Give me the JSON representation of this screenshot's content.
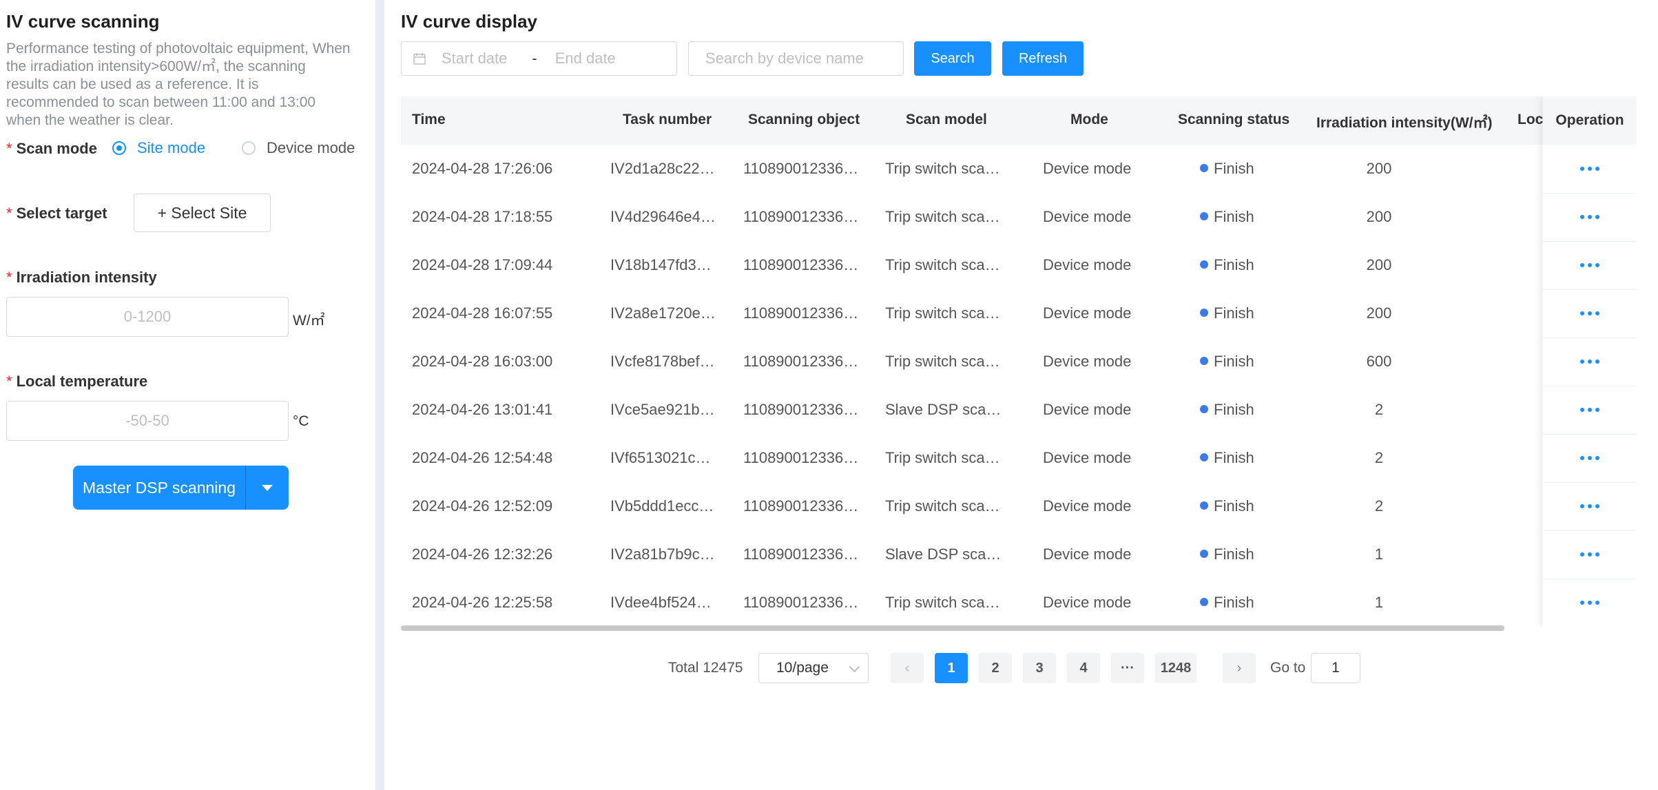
{
  "left": {
    "title": "IV curve scanning",
    "description": "Performance testing of photovoltaic equipment, When the irradiation intensity>600W/㎡, the scanning results can be used as a reference. It is recommended to scan between 11:00 and 13:00 when the weather is clear.",
    "scan_mode_label": "Scan mode",
    "scan_mode_options": [
      "Site mode",
      "Device mode"
    ],
    "scan_mode_selected": "Site mode",
    "select_target_label": "Select target",
    "select_site_button": "+ Select Site",
    "irradiation_label": "Irradiation intensity",
    "irradiation_placeholder": "0-1200",
    "irradiation_unit": "W/㎡",
    "temperature_label": "Local temperature",
    "temperature_placeholder": "-50-50",
    "temperature_unit": "°C",
    "scan_button": "Master DSP scanning"
  },
  "right": {
    "title": "IV curve display",
    "start_date_placeholder": "Start date",
    "date_separator": "-",
    "end_date_placeholder": "End date",
    "search_placeholder": "Search by device name",
    "search_button": "Search",
    "refresh_button": "Refresh"
  },
  "table": {
    "columns": [
      "Time",
      "Task number",
      "Scanning object",
      "Scan model",
      "Mode",
      "Scanning status",
      "Irradiation intensity(W/㎡)",
      "Loc",
      "Operation"
    ],
    "rows": [
      [
        "2024-04-28 17:26:06",
        "IV2d1a28c22…",
        "110890012336…",
        "Trip switch sca…",
        "Device mode",
        "Finish",
        "200"
      ],
      [
        "2024-04-28 17:18:55",
        "IV4d29646e4…",
        "110890012336…",
        "Trip switch sca…",
        "Device mode",
        "Finish",
        "200"
      ],
      [
        "2024-04-28 17:09:44",
        "IV18b147fd3…",
        "110890012336…",
        "Trip switch sca…",
        "Device mode",
        "Finish",
        "200"
      ],
      [
        "2024-04-28 16:07:55",
        "IV2a8e1720e…",
        "110890012336…",
        "Trip switch sca…",
        "Device mode",
        "Finish",
        "200"
      ],
      [
        "2024-04-28 16:03:00",
        "IVcfe8178bef…",
        "110890012336…",
        "Trip switch sca…",
        "Device mode",
        "Finish",
        "600"
      ],
      [
        "2024-04-26 13:01:41",
        "IVce5ae921b…",
        "110890012336…",
        "Slave DSP sca…",
        "Device mode",
        "Finish",
        "2"
      ],
      [
        "2024-04-26 12:54:48",
        "IVf6513021c…",
        "110890012336…",
        "Trip switch sca…",
        "Device mode",
        "Finish",
        "2"
      ],
      [
        "2024-04-26 12:52:09",
        "IVb5ddd1ecc…",
        "110890012336…",
        "Trip switch sca…",
        "Device mode",
        "Finish",
        "2"
      ],
      [
        "2024-04-26 12:32:26",
        "IV2a81b7b9c…",
        "110890012336…",
        "Slave DSP sca…",
        "Device mode",
        "Finish",
        "1"
      ],
      [
        "2024-04-26 12:25:58",
        "IVdee4bf524…",
        "110890012336…",
        "Trip switch sca…",
        "Device mode",
        "Finish",
        "1"
      ]
    ]
  },
  "pagination": {
    "total_label": "Total 12475",
    "page_size": "10/page",
    "pages": [
      "1",
      "2",
      "3",
      "4",
      "···",
      "1248"
    ],
    "current_page": "1",
    "goto_label": "Go to",
    "goto_value": "1"
  },
  "colors": {
    "primary": "#1890ff",
    "status_dot": "#3b7be8",
    "required": "#f5222d"
  }
}
